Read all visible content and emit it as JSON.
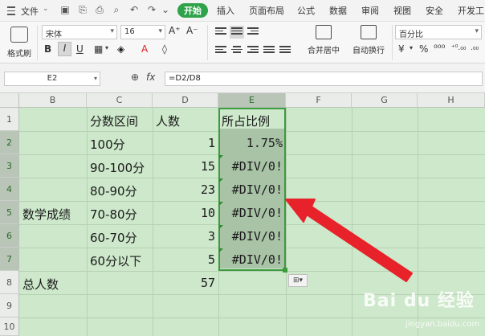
{
  "menu": {
    "file": "文件",
    "tabs": [
      "开始",
      "插入",
      "页面布局",
      "公式",
      "数据",
      "审阅",
      "视图",
      "安全",
      "开发工"
    ],
    "active_tab": 0
  },
  "ribbon": {
    "format_painter": "格式刷",
    "font_name": "宋体",
    "font_size": "16",
    "merge_center": "合并居中",
    "wrap_text": "自动换行",
    "number_format": "百分比"
  },
  "formula_bar": {
    "name_box": "E2",
    "formula": "=D2/D8"
  },
  "sheet": {
    "columns": [
      "B",
      "C",
      "D",
      "E",
      "F",
      "G",
      "H"
    ],
    "rows": [
      "1",
      "2",
      "3",
      "4",
      "5",
      "6",
      "7",
      "8",
      "9",
      "10"
    ],
    "header": {
      "c": "分数区间",
      "d": "人数",
      "e": "所占比例"
    },
    "data": [
      {
        "c": "100分",
        "d": "1",
        "e": "1.75%"
      },
      {
        "c": "90-100分",
        "d": "15",
        "e": "#DIV/0!"
      },
      {
        "c": "80-90分",
        "d": "23",
        "e": "#DIV/0!"
      },
      {
        "c": "70-80分",
        "d": "10",
        "e": "#DIV/0!"
      },
      {
        "c": "60-70分",
        "d": "3",
        "e": "#DIV/0!"
      },
      {
        "c": "60分以下",
        "d": "5",
        "e": "#DIV/0!"
      }
    ],
    "group_label": "数学成绩",
    "total_label": "总人数",
    "total_value": "57"
  },
  "watermark": {
    "text": "Bai du 经验",
    "sub": "jingyan.baidu.com"
  },
  "colors": {
    "accent": "#2fa34a",
    "grid_bg": "#cde8cb",
    "selection": "#3d9a3d",
    "arrow": "#e8222a"
  }
}
